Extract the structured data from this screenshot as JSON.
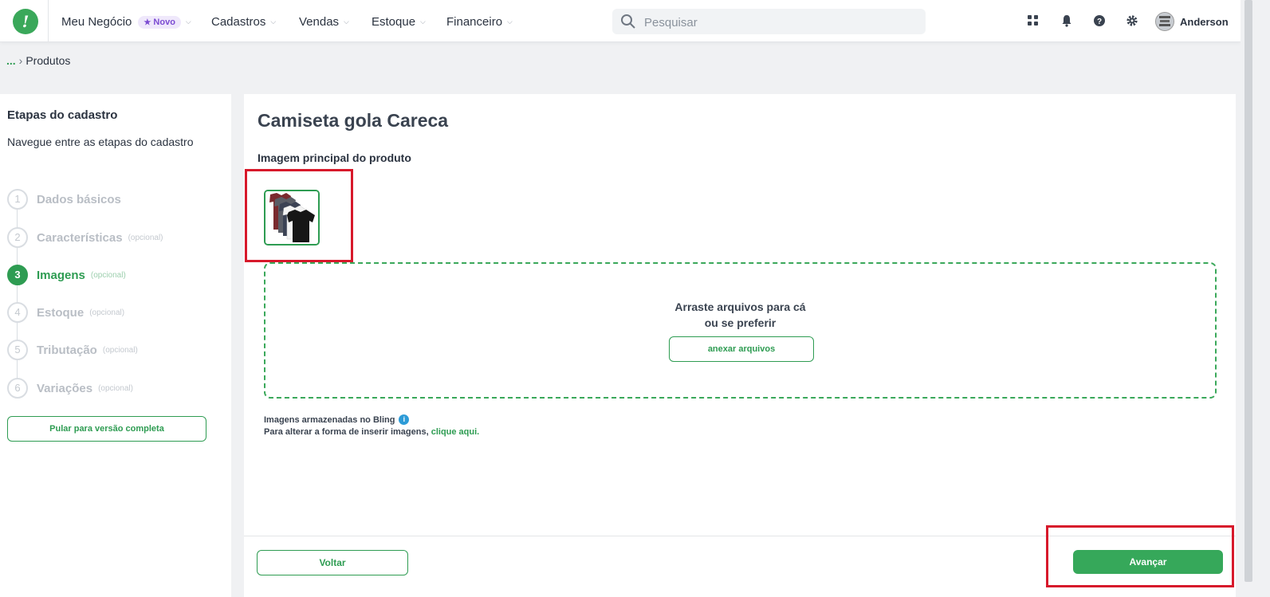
{
  "nav": {
    "brand": "Meu Negócio",
    "brand_badge": "Novo",
    "items": [
      {
        "label": "Cadastros"
      },
      {
        "label": "Vendas"
      },
      {
        "label": "Estoque"
      },
      {
        "label": "Financeiro"
      }
    ],
    "search_placeholder": "Pesquisar",
    "user": "Anderson"
  },
  "breadcrumb": {
    "ellipsis": "...",
    "current": "Produtos"
  },
  "sidebar": {
    "title": "Etapas do cadastro",
    "subtitle": "Navegue entre as etapas do cadastro",
    "steps": [
      {
        "num": "1",
        "label": "Dados básicos",
        "optional": ""
      },
      {
        "num": "2",
        "label": "Características",
        "optional": "(opcional)"
      },
      {
        "num": "3",
        "label": "Imagens",
        "optional": "(opcional)"
      },
      {
        "num": "4",
        "label": "Estoque",
        "optional": "(opcional)"
      },
      {
        "num": "5",
        "label": "Tributação",
        "optional": "(opcional)"
      },
      {
        "num": "6",
        "label": "Variações",
        "optional": "(opcional)"
      }
    ],
    "active_step": 3,
    "skip_button": "Pular para versão completa"
  },
  "main": {
    "product_title": "Camiseta gola Careca",
    "image_label": "Imagem principal do produto",
    "dropzone_line1": "Arraste arquivos para cá",
    "dropzone_line2": "ou se preferir",
    "attach_button": "anexar arquivos",
    "storage_note": "Imagens armazenadas no Bling",
    "change_note": "Para alterar a forma de inserir imagens,",
    "change_link": "clique aqui.",
    "back_button": "Voltar",
    "next_button": "Avançar"
  },
  "colors": {
    "accent": "#2e9c52",
    "highlight": "#d7192b",
    "badge": "#7b4bd2"
  }
}
